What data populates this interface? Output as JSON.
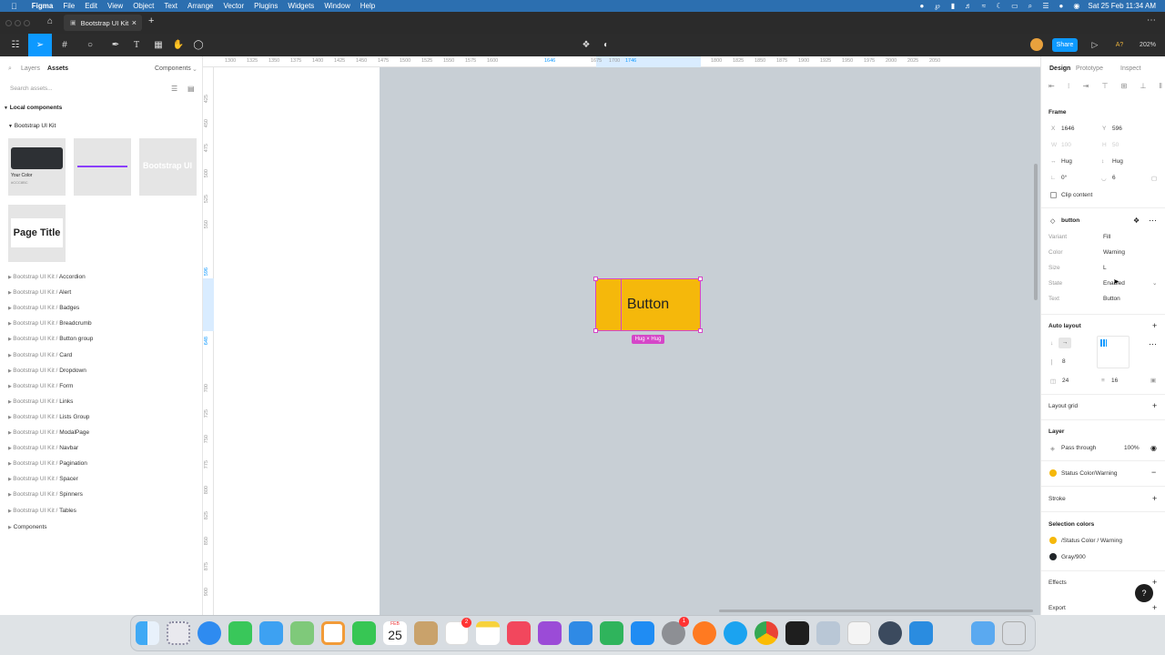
{
  "menubar": {
    "app": "Figma",
    "items": [
      "File",
      "Edit",
      "View",
      "Object",
      "Text",
      "Arrange",
      "Vector",
      "Plugins",
      "Widgets",
      "Window",
      "Help"
    ],
    "clock": "Sat 25 Feb 11:34 AM"
  },
  "tabbar": {
    "tab_title": "Bootstrap UI Kit"
  },
  "toolbar": {
    "share_label": "Share",
    "zoom": "202%",
    "ai_label": "A?"
  },
  "leftpanel": {
    "tabs": [
      "Layers",
      "Assets"
    ],
    "components_dropdown": "Components",
    "search_placeholder": "Search assets...",
    "local_components": "Local components",
    "kit_name": "Bootstrap UI Kit",
    "thumb1_title": "Your Color",
    "thumb1_sub": "#CCC8BC",
    "thumb3_text": "Bootstrap UI",
    "page_title_thumb": "Page Title",
    "asset_prefix": "Bootstrap UI Kit /",
    "assets": [
      "Accordion",
      "Alert",
      "Badges",
      "Breadcrumb",
      "Button group",
      "Card",
      "Dropdown",
      "Form",
      "Links",
      "Lists Group",
      "ModalPage",
      "Navbar",
      "Pagination",
      "Spacer",
      "Spinners",
      "Tables"
    ],
    "components_folder": "Components"
  },
  "rulers": {
    "top_ticks": [
      "1300",
      "1325",
      "1350",
      "1375",
      "1400",
      "1425",
      "1450",
      "1475",
      "1500",
      "1525",
      "1550",
      "1575",
      "1600",
      "1646",
      "1675",
      "1700",
      "1746",
      "1800",
      "1825",
      "1850",
      "1875",
      "1900",
      "1925",
      "1950",
      "1975",
      "2000",
      "2025",
      "2050"
    ],
    "left_ticks": [
      "425",
      "450",
      "475",
      "500",
      "525",
      "550",
      "596",
      "648",
      "700",
      "725",
      "750",
      "775",
      "800",
      "825",
      "850",
      "875",
      "900"
    ]
  },
  "canvas": {
    "button_text": "Button",
    "hug_badge": "Hug × Hug"
  },
  "rightpanel": {
    "tabs": [
      "Design",
      "Prototype",
      "Inspect"
    ],
    "frame_title": "Frame",
    "x_label": "X",
    "x_val": "1646",
    "y_label": "Y",
    "y_val": "596",
    "w_label": "W",
    "w_val": "100",
    "h_label": "H",
    "h_val": "50",
    "hug_w": "Hug",
    "hug_h": "Hug",
    "rotation": "0°",
    "radius": "6",
    "clip_content": "Clip content",
    "component_name": "button",
    "props": [
      {
        "label": "Variant",
        "value": "Fill"
      },
      {
        "label": "Color",
        "value": "Warning"
      },
      {
        "label": "Size",
        "value": "L"
      },
      {
        "label": "State",
        "value": "Enabled"
      },
      {
        "label": "Text",
        "value": "Button"
      }
    ],
    "auto_layout": "Auto layout",
    "gap": "8",
    "pad_h": "24",
    "pad_v": "16",
    "layout_grid": "Layout grid",
    "layer": "Layer",
    "blend": "Pass through",
    "opacity": "100%",
    "fill_style": "Status Color/Warning",
    "stroke": "Stroke",
    "selection_colors": "Selection colors",
    "sel_color1": "/Status Color / Warning",
    "sel_color2": "Gray/900",
    "effects": "Effects",
    "export": "Export",
    "help": "?"
  },
  "dock": {
    "calendar_month": "FEB",
    "calendar_day": "25",
    "reminders_badge": "2",
    "settings_badge": "1"
  },
  "colors": {
    "accent": "#0d99ff",
    "warning": "#f5b80b",
    "selection": "#d546c8",
    "menubar": "#2c6fb0"
  }
}
